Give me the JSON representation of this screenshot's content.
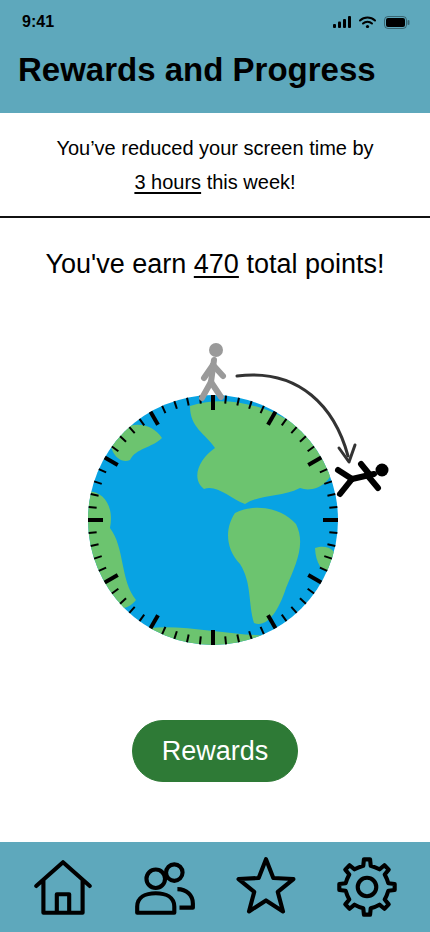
{
  "status_bar": {
    "time": "9:41"
  },
  "header": {
    "title": "Rewards and Progress"
  },
  "screen_time": {
    "prefix": "You’ve reduced your screen time by",
    "amount": "3 hours",
    "suffix": "this week!"
  },
  "points": {
    "prefix": "You've earn",
    "amount": "470",
    "suffix": "total points!"
  },
  "rewards_button": {
    "label": "Rewards"
  }
}
